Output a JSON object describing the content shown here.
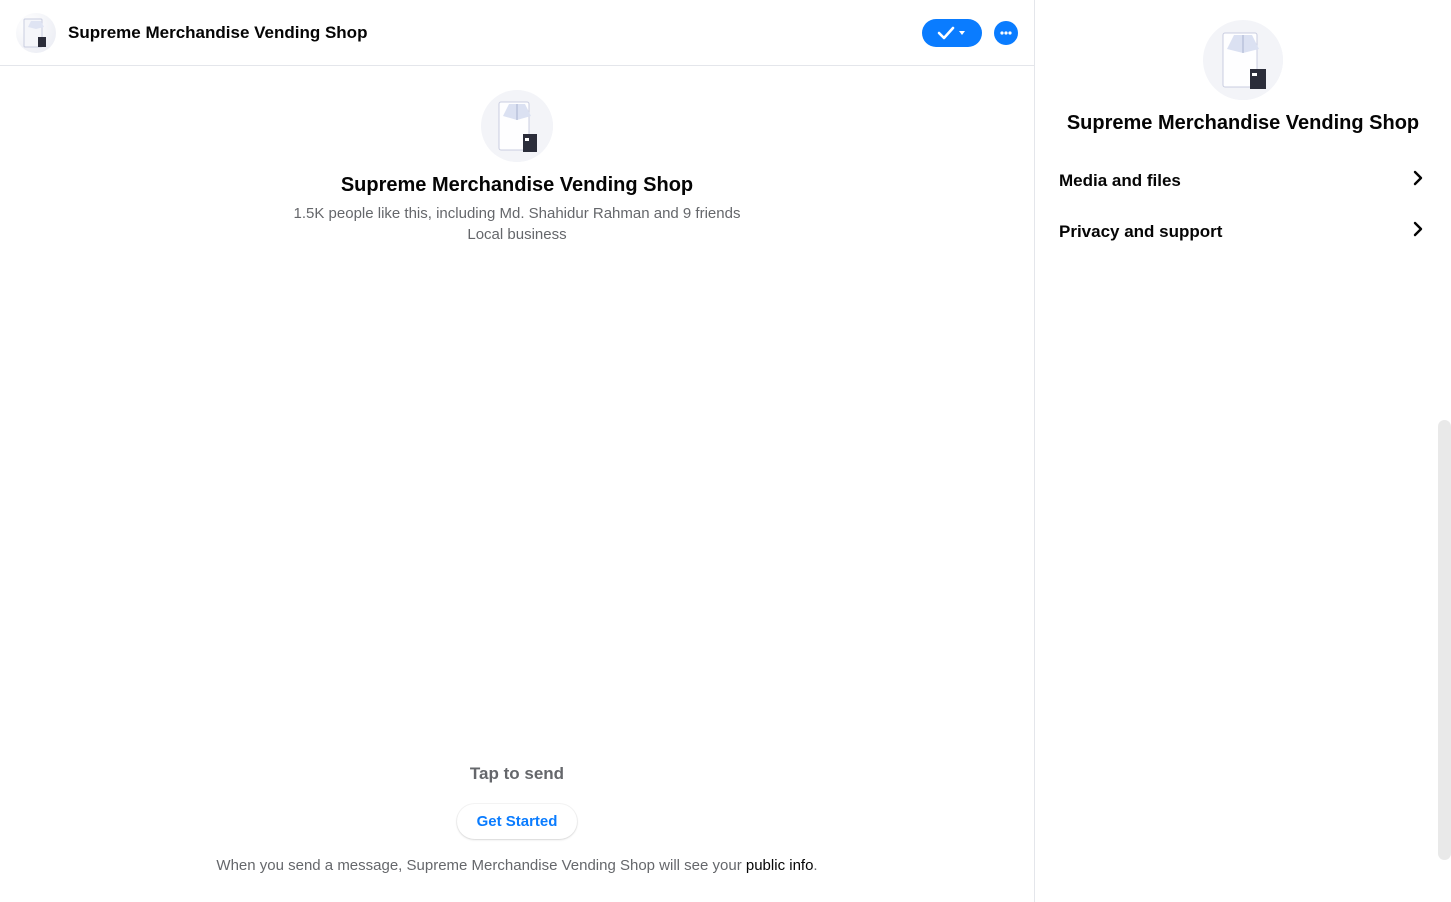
{
  "header": {
    "title": "Supreme Merchandise Vending Shop"
  },
  "intro": {
    "name": "Supreme Merchandise Vending Shop",
    "likes_line": "1.5K people like this, including Md. Shahidur Rahman and 9 friends",
    "category": "Local business"
  },
  "prompt": {
    "tap_to_send": "Tap to send",
    "get_started": "Get Started",
    "disclosure_pre": "When you send a message, Supreme Merchandise Vending Shop will see your ",
    "disclosure_link": "public info",
    "disclosure_post": "."
  },
  "right_panel": {
    "title": "Supreme Merchandise Vending Shop",
    "items": [
      {
        "label": "Media and files"
      },
      {
        "label": "Privacy and support"
      }
    ]
  }
}
